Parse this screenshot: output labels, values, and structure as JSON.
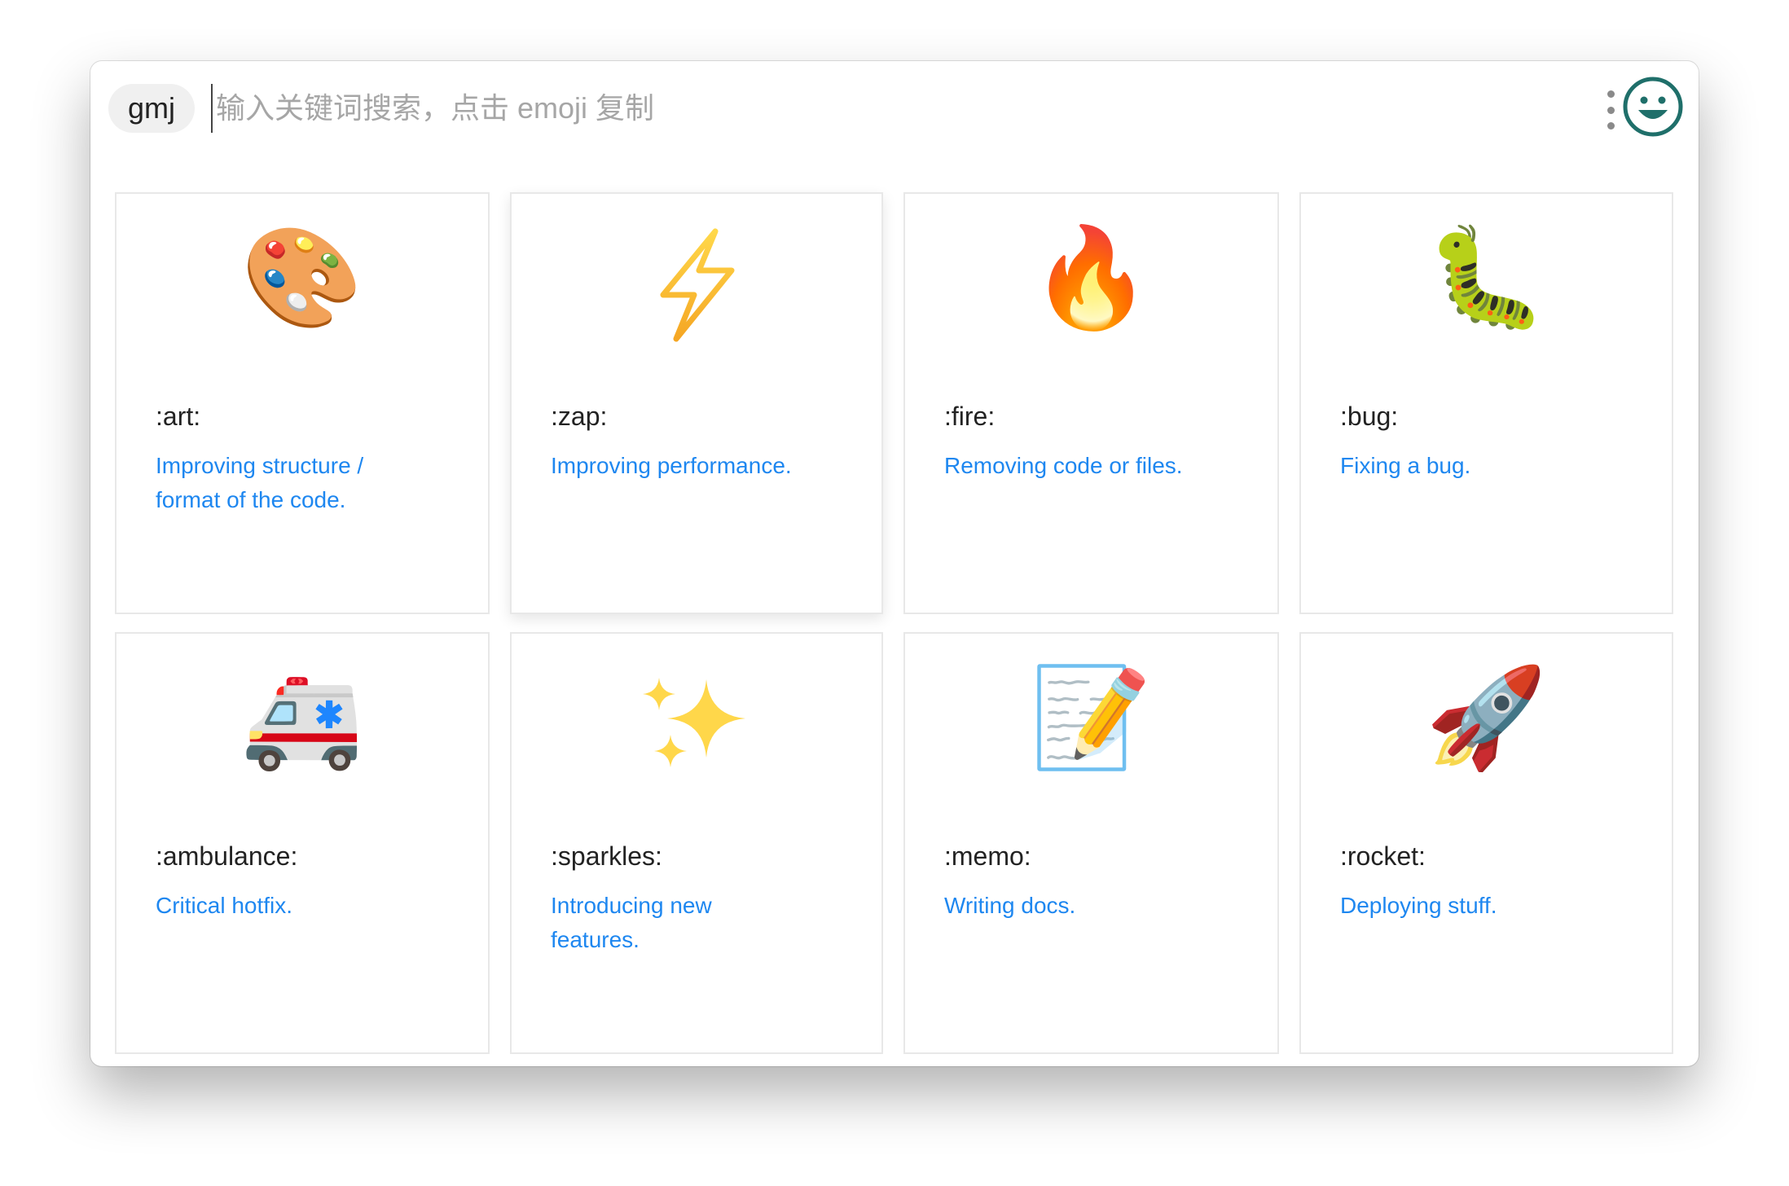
{
  "search": {
    "tag": "gmj",
    "placeholder": "输入关键词搜索，点击 emoji 复制",
    "value": ""
  },
  "colors": {
    "accent": "#1e87f0",
    "logo": "#1f6f6a"
  },
  "icons": {
    "menu": "vertical-dots-icon",
    "logo": "smiley-icon"
  },
  "cards": [
    {
      "emoji": "🎨",
      "icon": "palette-icon",
      "code": ":art:",
      "description": "Improving structure / format of the code."
    },
    {
      "emoji": "⚡",
      "icon": "zap-icon",
      "code": ":zap:",
      "description": "Improving performance."
    },
    {
      "emoji": "🔥",
      "icon": "fire-icon",
      "code": ":fire:",
      "description": "Removing code or files."
    },
    {
      "emoji": "🐛",
      "icon": "bug-icon",
      "code": ":bug:",
      "description": "Fixing a bug."
    },
    {
      "emoji": "🚑",
      "icon": "ambulance-icon",
      "code": ":ambulance:",
      "description": "Critical hotfix."
    },
    {
      "emoji": "✨",
      "icon": "sparkles-icon",
      "code": ":sparkles:",
      "description": "Introducing new features."
    },
    {
      "emoji": "📝",
      "icon": "memo-icon",
      "code": ":memo:",
      "description": "Writing docs."
    },
    {
      "emoji": "🚀",
      "icon": "rocket-icon",
      "code": ":rocket:",
      "description": "Deploying stuff."
    }
  ]
}
